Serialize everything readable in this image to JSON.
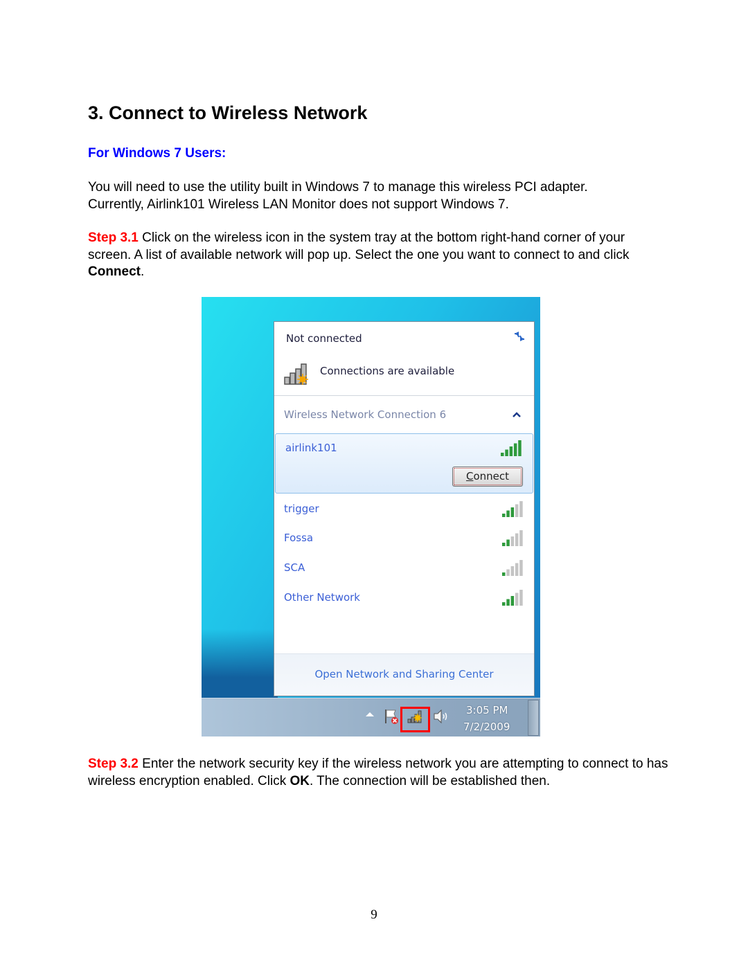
{
  "document": {
    "heading": "3. Connect to Wireless Network",
    "subheading": "For Windows 7 Users:",
    "intro": {
      "line1": "You will need to use the utility built in Windows 7 to manage this wireless PCI adapter.",
      "line2": "Currently, Airlink101 Wireless LAN Monitor does not support Windows 7."
    },
    "step1": {
      "label": "Step 3.1",
      "text": " Click on the wireless icon in the system tray at the bottom right-hand corner of your screen. A list of available network will pop up. Select the one you want to connect to and click ",
      "bold": "Connect",
      "end": "."
    },
    "step2": {
      "label": "Step 3.2",
      "text": " Enter the network security key if the wireless network you are attempting to connect to has wireless encryption enabled. Click ",
      "bold": "OK",
      "end": ". The connection will be established then."
    },
    "page_number": "9"
  },
  "screenshot": {
    "flyout": {
      "title": "Not connected",
      "status": "Connections are available",
      "adapter": "Wireless Network Connection 6",
      "networks": [
        {
          "name": "airlink101",
          "signal_bars": 5,
          "selected": true
        },
        {
          "name": "trigger",
          "signal_bars": 3
        },
        {
          "name": "Fossa",
          "signal_bars": 2
        },
        {
          "name": "SCA",
          "signal_bars": 1
        },
        {
          "name": "Other Network",
          "signal_bars": 3
        }
      ],
      "connect_button": {
        "first": "C",
        "rest": "onnect"
      },
      "footer_link": "Open Network and Sharing Center"
    },
    "taskbar": {
      "time": "3:05 PM",
      "date": "7/2/2009"
    },
    "colors": {
      "link": "#3b5fd6",
      "highlight": "#ff0000",
      "signal_on": "#2e9a3c",
      "signal_off": "#c4c4c4"
    }
  }
}
